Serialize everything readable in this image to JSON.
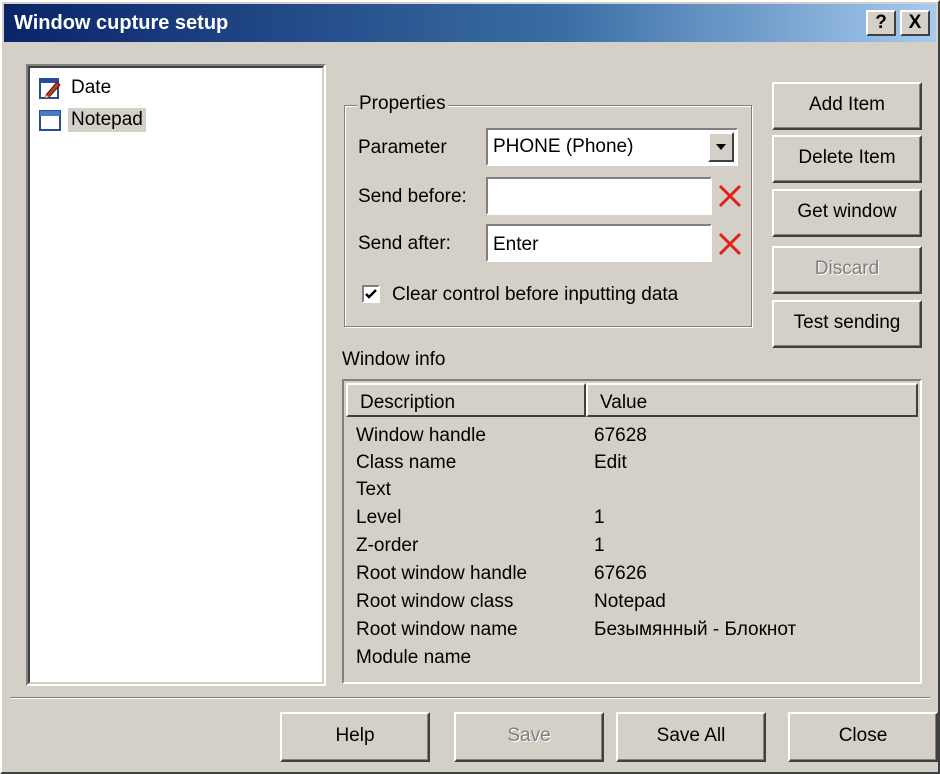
{
  "window": {
    "title": "Window cupture setup",
    "help_glyph": "?",
    "close_glyph": "X"
  },
  "tree": {
    "items": [
      {
        "label": "Date",
        "icon": "pencil-document-icon",
        "selected": false
      },
      {
        "label": "Notepad",
        "icon": "window-icon",
        "selected": true
      }
    ]
  },
  "properties": {
    "legend": "Properties",
    "parameter_label": "Parameter",
    "parameter_value": "PHONE (Phone)",
    "send_before_label": "Send before:",
    "send_before_value": "",
    "send_after_label": "Send after:",
    "send_after_value": "Enter",
    "clear_label": "Clear control before inputting data",
    "clear_checked": true
  },
  "side_buttons": {
    "add": "Add Item",
    "delete": "Delete Item",
    "get_window": "Get window",
    "discard": "Discard",
    "test": "Test sending"
  },
  "window_info": {
    "label": "Window info",
    "columns": [
      "Description",
      "Value"
    ],
    "rows": [
      {
        "desc": "Window handle",
        "value": "67628"
      },
      {
        "desc": "Class name",
        "value": "Edit"
      },
      {
        "desc": "Text",
        "value": ""
      },
      {
        "desc": "Level",
        "value": "1"
      },
      {
        "desc": "Z-order",
        "value": "1"
      },
      {
        "desc": "Root window handle",
        "value": "67626"
      },
      {
        "desc": "Root window class",
        "value": "Notepad"
      },
      {
        "desc": "Root window name",
        "value": "Безымянный - Блокнот"
      },
      {
        "desc": "Module name",
        "value": ""
      }
    ]
  },
  "footer": {
    "help": "Help",
    "save": "Save",
    "save_all": "Save All",
    "close": "Close"
  },
  "colors": {
    "title_start": "#0a246a",
    "title_end": "#a6caf0",
    "face": "#d4d0c8",
    "clear_x": "#e0201a"
  }
}
